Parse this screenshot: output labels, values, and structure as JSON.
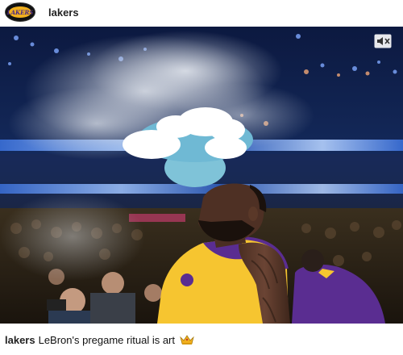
{
  "header": {
    "username": "lakers",
    "avatar_text": "LAKERS"
  },
  "post": {
    "mute_icon": "speaker-muted-icon"
  },
  "caption": {
    "username": "lakers",
    "text": "LeBron's pregame ritual is art",
    "emoji_icon": "crown-icon"
  },
  "colors": {
    "lakers_gold": "#f6c530",
    "lakers_purple": "#5a2d91",
    "arena_blue": "#0d1530"
  }
}
